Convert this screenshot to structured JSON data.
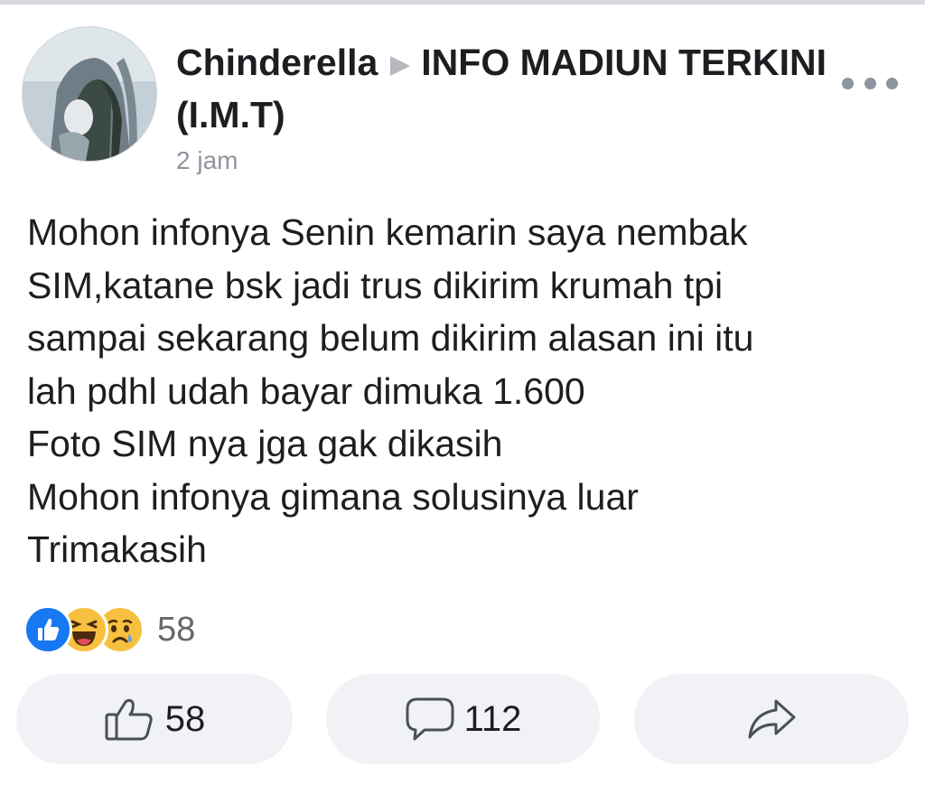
{
  "post": {
    "author": "Chinderella",
    "group": "INFO MADIUN TERKINI (I.M.T)",
    "timestamp": "2 jam",
    "body_lines": [
      "Mohon infonya Senin kemarin saya nembak",
      "SIM,katane bsk jadi trus dikirim krumah tpi",
      "sampai sekarang belum dikirim alasan ini itu",
      "lah pdhl udah bayar dimuka 1.600",
      "Foto SIM nya jga gak dikasih",
      "Mohon infonya gimana solusinya luar",
      "Trimakasih"
    ]
  },
  "reactions": {
    "icons": [
      "like-reaction-icon",
      "haha-reaction-icon",
      "sad-reaction-icon"
    ],
    "count": "58"
  },
  "actions": {
    "like_count": "58",
    "comment_count": "112"
  },
  "colors": {
    "text": "#1c1e21",
    "muted": "#90949c",
    "button_bg": "#f0f2f5",
    "like_blue": "#1877f2",
    "emoji_yellow": "#f7c03f"
  }
}
